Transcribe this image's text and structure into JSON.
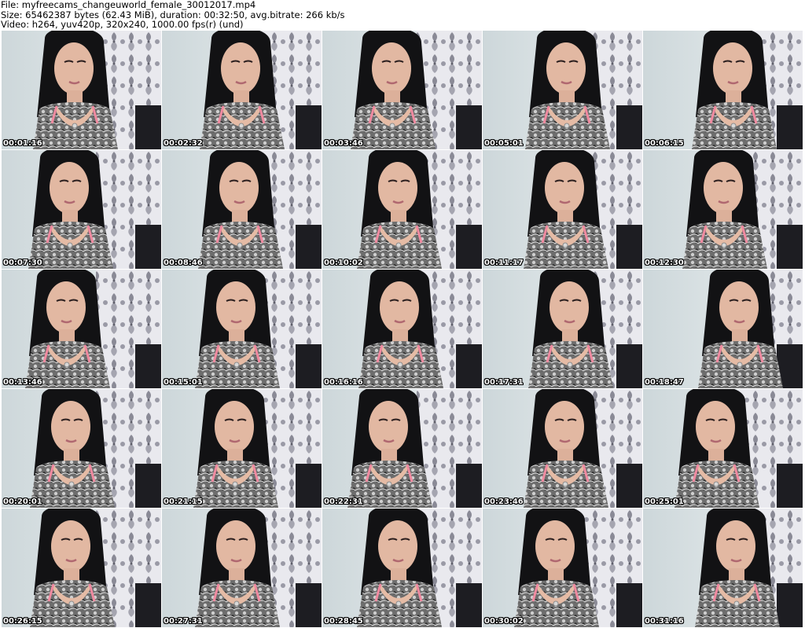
{
  "header": {
    "file_line": "File: myfreecams_changeuworld_female_30012017.mp4",
    "size_line": "Size: 65462387 bytes (62.43 MiB), duration: 00:32:50, avg.bitrate: 266 kb/s",
    "video_line": "Video: h264, yuv420p, 320x240, 1000.00 fps(r) (und)"
  },
  "thumbnails": [
    {
      "time": "00:01:16"
    },
    {
      "time": "00:02:32"
    },
    {
      "time": "00:03:46"
    },
    {
      "time": "00:05:01"
    },
    {
      "time": "00:06:15"
    },
    {
      "time": "00:07:30"
    },
    {
      "time": "00:08:46"
    },
    {
      "time": "00:10:02"
    },
    {
      "time": "00:11:17"
    },
    {
      "time": "00:12:30"
    },
    {
      "time": "00:13:46"
    },
    {
      "time": "00:15:01"
    },
    {
      "time": "00:16:16"
    },
    {
      "time": "00:17:31"
    },
    {
      "time": "00:18:47"
    },
    {
      "time": "00:20:01"
    },
    {
      "time": "00:21:15"
    },
    {
      "time": "00:22:31"
    },
    {
      "time": "00:23:46"
    },
    {
      "time": "00:25:01"
    },
    {
      "time": "00:26:15"
    },
    {
      "time": "00:27:31"
    },
    {
      "time": "00:28:45"
    },
    {
      "time": "00:30:02"
    },
    {
      "time": "00:31:16"
    }
  ]
}
